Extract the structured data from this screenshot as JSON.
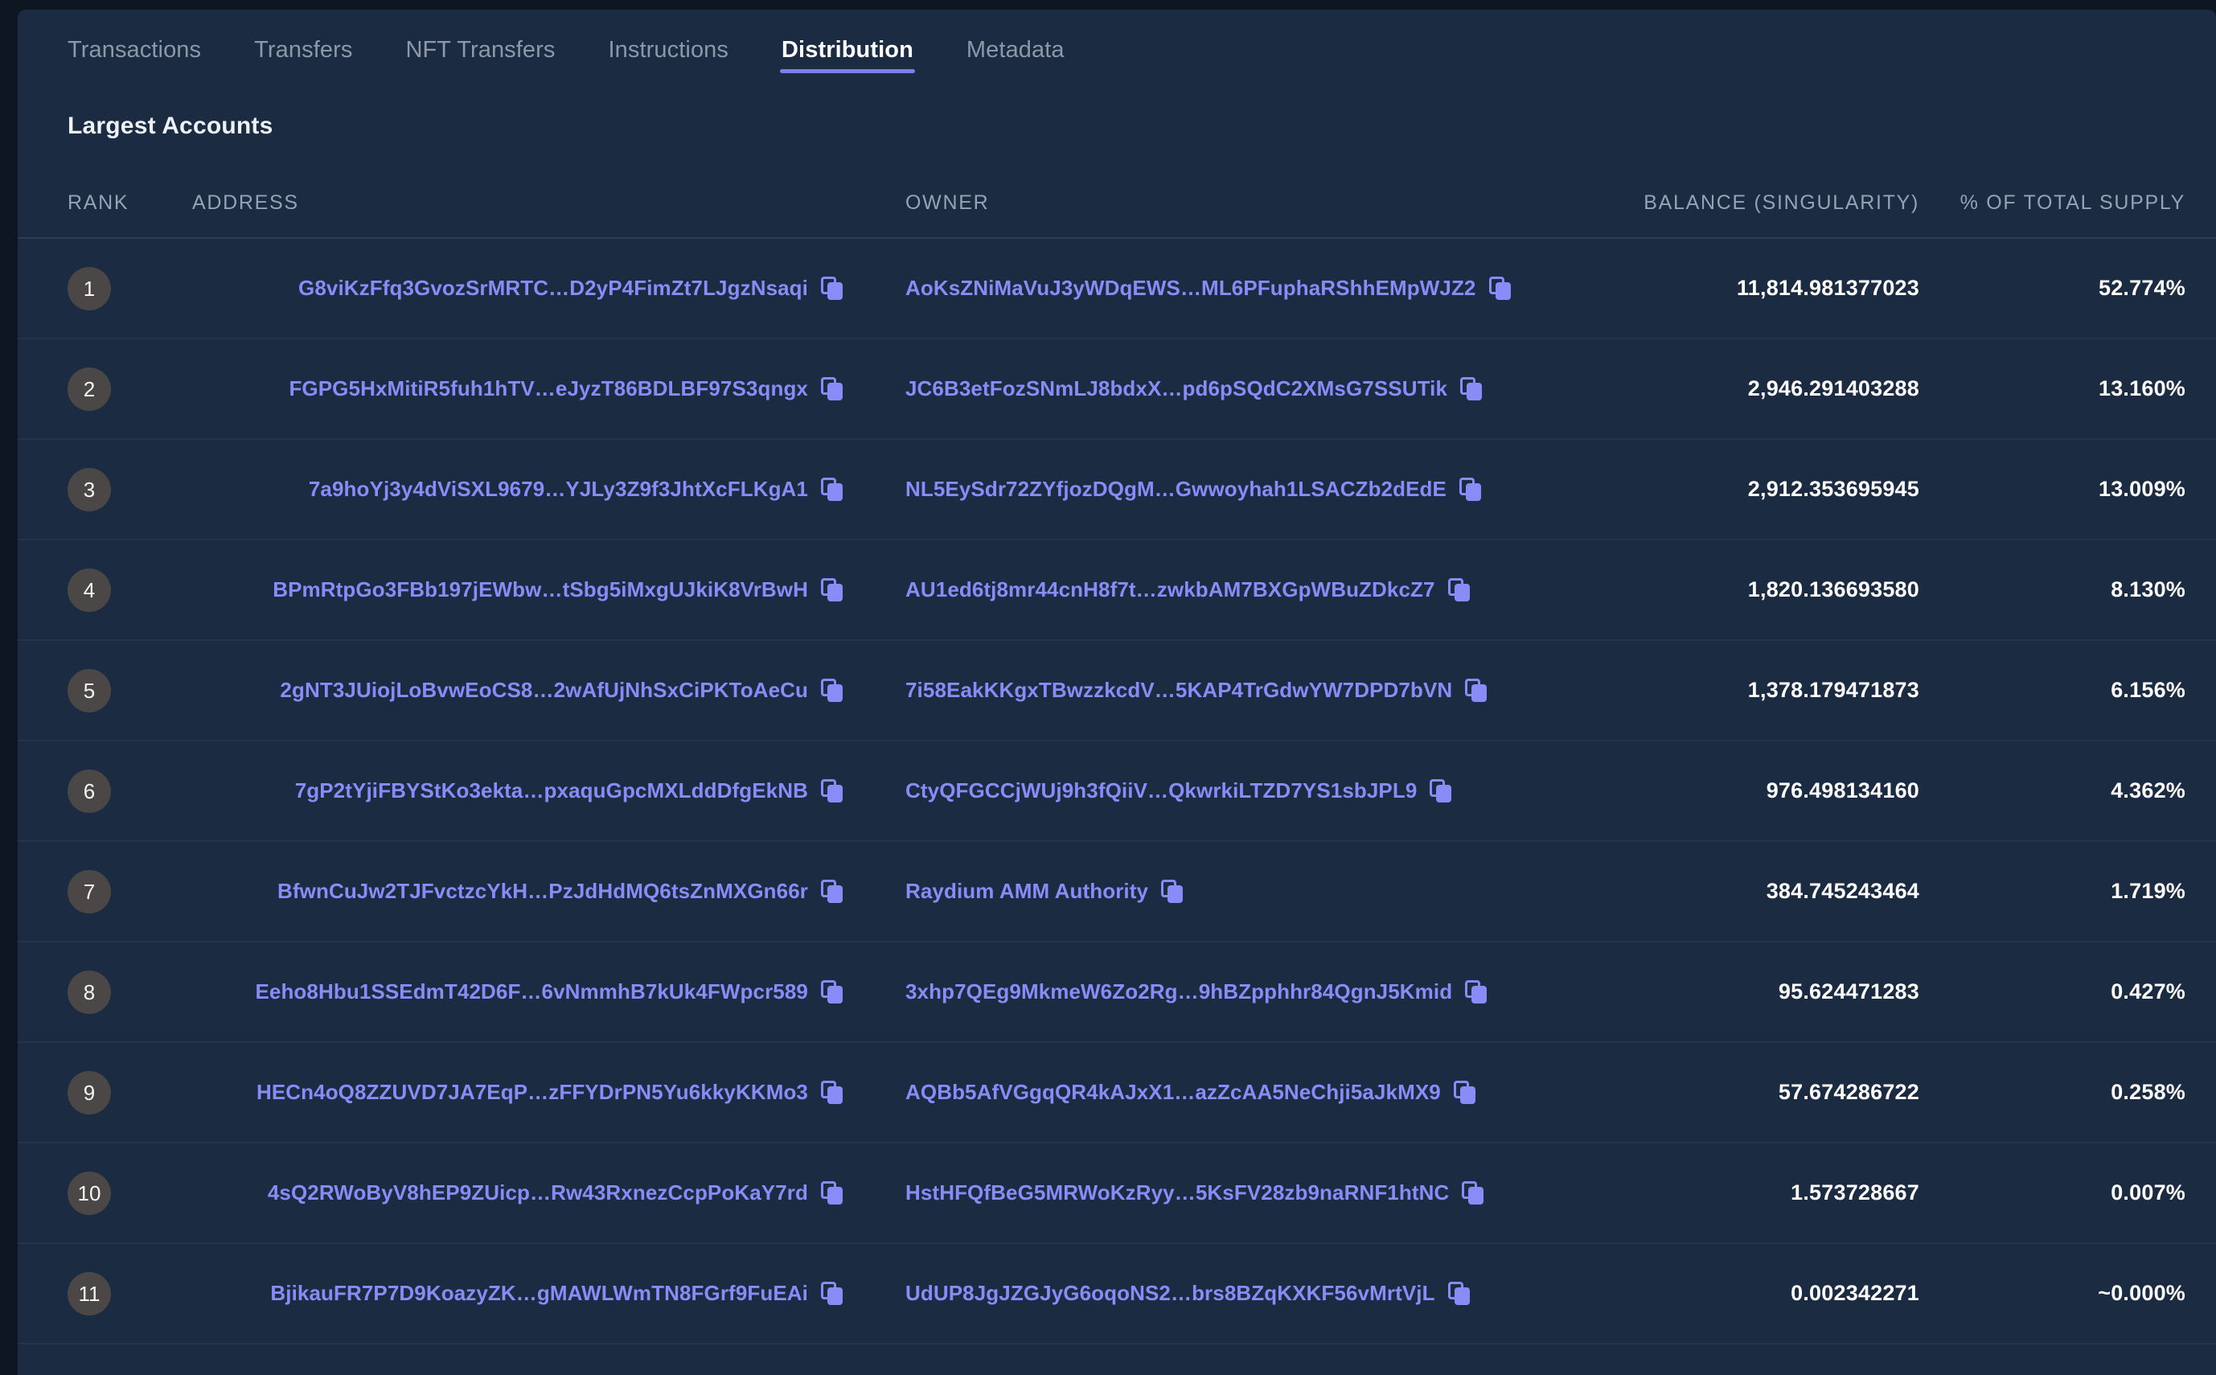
{
  "tabs": [
    {
      "label": "Transactions",
      "active": false
    },
    {
      "label": "Transfers",
      "active": false
    },
    {
      "label": "NFT Transfers",
      "active": false
    },
    {
      "label": "Instructions",
      "active": false
    },
    {
      "label": "Distribution",
      "active": true
    },
    {
      "label": "Metadata",
      "active": false
    }
  ],
  "section": {
    "title": "Largest Accounts"
  },
  "table": {
    "columns": [
      "RANK",
      "ADDRESS",
      "OWNER",
      "BALANCE (SINGULARITY)",
      "% OF TOTAL SUPPLY"
    ],
    "rows": [
      {
        "rank": "1",
        "address": "G8viKzFfq3GvozSrMRTC…D2yP4FimZt7LJgzNsaqi",
        "owner": "AoKsZNiMaVuJ3yWDqEWS…ML6PFuphaRShhEMpWJZ2",
        "balance": "11,814.981377023",
        "percent": "52.774%"
      },
      {
        "rank": "2",
        "address": "FGPG5HxMitiR5fuh1hTV…eJyzT86BDLBF97S3qngx",
        "owner": "JC6B3etFozSNmLJ8bdxX…pd6pSQdC2XMsG7SSUTik",
        "balance": "2,946.291403288",
        "percent": "13.160%"
      },
      {
        "rank": "3",
        "address": "7a9hoYj3y4dViSXL9679…YJLy3Z9f3JhtXcFLKgA1",
        "owner": "NL5EySdr72ZYfjozDQgM…Gwwoyhah1LSACZb2dEdE",
        "balance": "2,912.353695945",
        "percent": "13.009%"
      },
      {
        "rank": "4",
        "address": "BPmRtpGo3FBb197jEWbw…tSbg5iMxgUJkiK8VrBwH",
        "owner": "AU1ed6tj8mr44cnH8f7t…zwkbAM7BXGpWBuZDkcZ7",
        "balance": "1,820.136693580",
        "percent": "8.130%"
      },
      {
        "rank": "5",
        "address": "2gNT3JUiojLoBvwEoCS8…2wAfUjNhSxCiPKToAeCu",
        "owner": "7i58EakKKgxTBwzzkcdV…5KAP4TrGdwYW7DPD7bVN",
        "balance": "1,378.179471873",
        "percent": "6.156%"
      },
      {
        "rank": "6",
        "address": "7gP2tYjiFBYStKo3ekta…pxaquGpcMXLddDfgEkNB",
        "owner": "CtyQFGCCjWUj9h3fQiiV…QkwrkiLTZD7YS1sbJPL9",
        "balance": "976.498134160",
        "percent": "4.362%"
      },
      {
        "rank": "7",
        "address": "BfwnCuJw2TJFvctzcYkH…PzJdHdMQ6tsZnMXGn66r",
        "owner": "Raydium AMM Authority",
        "balance": "384.745243464",
        "percent": "1.719%"
      },
      {
        "rank": "8",
        "address": "Eeho8Hbu1SSEdmT42D6F…6vNmmhB7kUk4FWpcr589",
        "owner": "3xhp7QEg9MkmeW6Zo2Rg…9hBZpphhr84QgnJ5Kmid",
        "balance": "95.624471283",
        "percent": "0.427%"
      },
      {
        "rank": "9",
        "address": "HECn4oQ8ZZUVD7JA7EqP…zFFYDrPN5Yu6kkyKKMo3",
        "owner": "AQBb5AfVGgqQR4kAJxX1…azZcAA5NeChji5aJkMX9",
        "balance": "57.674286722",
        "percent": "0.258%"
      },
      {
        "rank": "10",
        "address": "4sQ2RWoByV8hEP9ZUicp…Rw43RxnezCcpPoKaY7rd",
        "owner": "HstHFQfBeG5MRWoKzRyy…5KsFV28zb9naRNF1htNC",
        "balance": "1.573728667",
        "percent": "0.007%"
      },
      {
        "rank": "11",
        "address": "BjikauFR7P7D9KoazyZK…gMAWLWmTN8FGrf9FuEAi",
        "owner": "UdUP8JgJZGJyG6oqoNS2…brs8BZqKXKF56vMrtVjL",
        "balance": "0.002342271",
        "percent": "~0.000%"
      }
    ]
  },
  "icons": {
    "copy": "copy-icon"
  },
  "colors": {
    "background": "#0e1622",
    "card": "#1b2b41",
    "accent": "#7b7ff0",
    "link": "#8b8bf8",
    "header_text": "#97a3b4",
    "value_text": "#ffffff",
    "rank_badge": "#4a4746",
    "row_divider": "#24344a"
  }
}
